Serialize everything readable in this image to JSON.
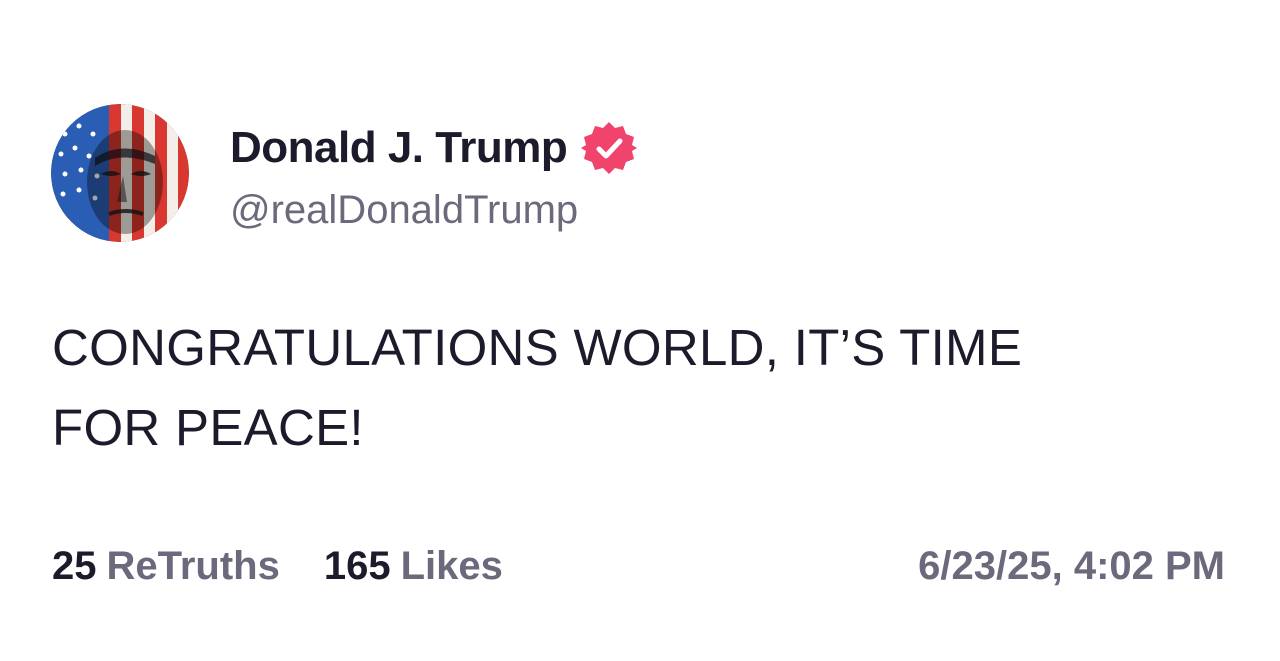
{
  "post": {
    "author": {
      "display_name": "Donald J. Trump",
      "handle": "@realDonaldTrump",
      "verified_icon": "verified-badge-icon",
      "verified_color": "#f0446d"
    },
    "content": {
      "line1": "CONGRATULATIONS WORLD, IT’S TIME",
      "line2": "FOR PEACE!"
    },
    "stats": {
      "retruths_count": "25",
      "retruths_label": "ReTruths",
      "likes_count": "165",
      "likes_label": "Likes"
    },
    "timestamp": "6/23/25, 4:02 PM"
  }
}
